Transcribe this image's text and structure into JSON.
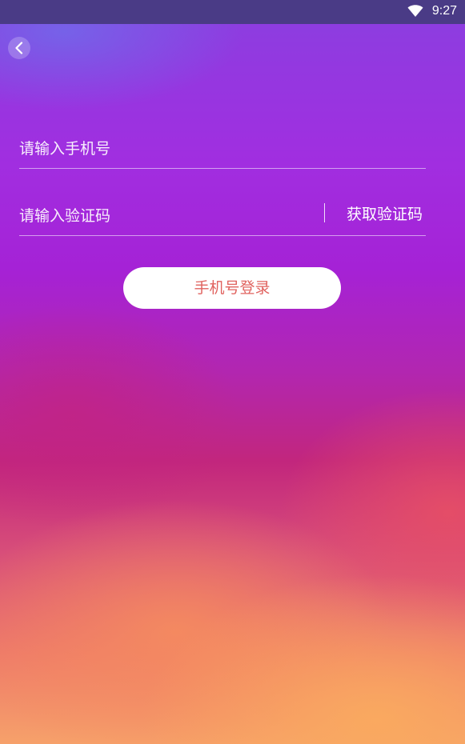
{
  "status_bar": {
    "time": "9:27",
    "wifi_icon": "wifi-icon"
  },
  "header": {
    "back_icon": "chevron-left-icon"
  },
  "form": {
    "phone_placeholder": "请输入手机号",
    "code_placeholder": "请输入验证码",
    "get_code_label": "获取验证码",
    "login_label": "手机号登录"
  },
  "colors": {
    "login_text": "#e0635f",
    "status_bar_bg": "#4a3b86"
  }
}
